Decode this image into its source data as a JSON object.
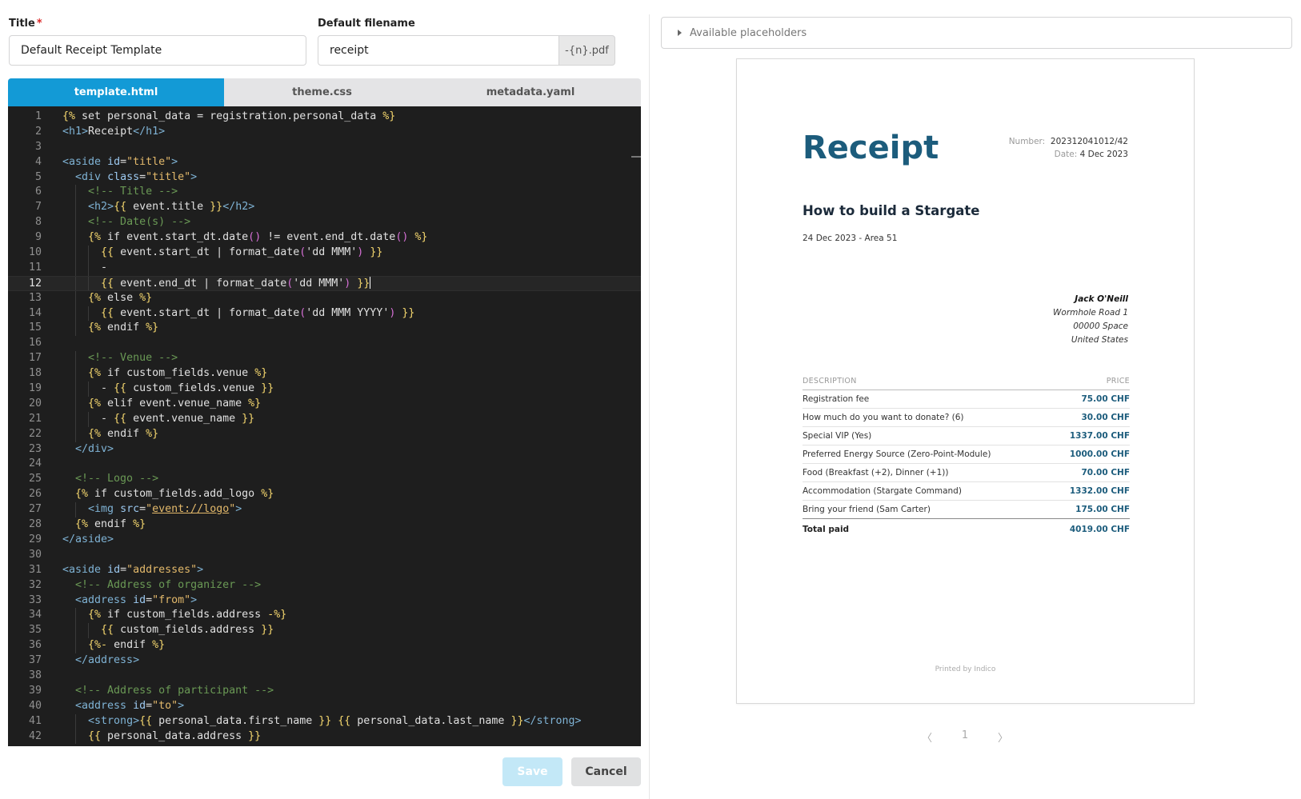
{
  "form": {
    "title_label": "Title",
    "title_required_mark": "*",
    "title_value": "Default Receipt Template",
    "filename_label": "Default filename",
    "filename_value": "receipt",
    "filename_suffix": "-{n}.pdf"
  },
  "tabs": [
    "template.html",
    "theme.css",
    "metadata.yaml"
  ],
  "editor": {
    "line_numbers": [
      "1",
      "2",
      "3",
      "4",
      "5",
      "6",
      "7",
      "8",
      "9",
      "10",
      "11",
      "12",
      "13",
      "14",
      "15",
      "16",
      "17",
      "18",
      "19",
      "20",
      "21",
      "22",
      "23",
      "24",
      "25",
      "26",
      "27",
      "28",
      "29",
      "30",
      "31",
      "32",
      "33",
      "34",
      "35",
      "36",
      "37",
      "38",
      "39",
      "40",
      "41",
      "42"
    ],
    "lines": [
      "{% set personal_data = registration.personal_data %}",
      "<h1>Receipt</h1>",
      "",
      "<aside id=\"title\">",
      "  <div class=\"title\">",
      "    <!-- Title -->",
      "    <h2>{{ event.title }}</h2>",
      "    <!-- Date(s) -->",
      "    {% if event.start_dt.date() != event.end_dt.date() %}",
      "      {{ event.start_dt | format_date('dd MMM') }}",
      "      -",
      "      {{ event.end_dt | format_date('dd MMM') }}",
      "    {% else %}",
      "      {{ event.start_dt | format_date('dd MMM YYYY') }}",
      "    {% endif %}",
      "",
      "    <!-- Venue -->",
      "    {% if custom_fields.venue %}",
      "      - {{ custom_fields.venue }}",
      "    {% elif event.venue_name %}",
      "      - {{ event.venue_name }}",
      "    {% endif %}",
      "  </div>",
      "",
      "  <!-- Logo -->",
      "  {% if custom_fields.add_logo %}",
      "    <img src=\"event://logo\">",
      "  {% endif %}",
      "</aside>",
      "",
      "<aside id=\"addresses\">",
      "  <!-- Address of organizer -->",
      "  <address id=\"from\">",
      "    {% if custom_fields.address -%}",
      "      {{ custom_fields.address }}",
      "    {%- endif %}",
      "  </address>",
      "",
      "  <!-- Address of participant -->",
      "  <address id=\"to\">",
      "    <strong>{{ personal_data.first_name }} {{ personal_data.last_name }}</strong>",
      "    {{ personal_data.address }}"
    ]
  },
  "buttons": {
    "save": "Save",
    "cancel": "Cancel"
  },
  "placeholders_label": "Available placeholders",
  "receipt": {
    "heading": "Receipt",
    "number_label": "Number:",
    "number_value": "202312041012/42",
    "date_label": "Date:",
    "date_value": "4 Dec 2023",
    "event_title": "How to build a Stargate",
    "event_sub": "24 Dec 2023 - Area 51",
    "address": [
      "Jack O'Neill",
      "Wormhole Road 1",
      "00000 Space",
      "United States"
    ],
    "col_description": "DESCRIPTION",
    "col_price": "PRICE",
    "items": [
      {
        "desc": "Registration fee",
        "price": "75.00 CHF"
      },
      {
        "desc": "How much do you want to donate? (6)",
        "price": "30.00 CHF"
      },
      {
        "desc": "Special VIP (Yes)",
        "price": "1337.00 CHF"
      },
      {
        "desc": "Preferred Energy Source (Zero-Point-Module)",
        "price": "1000.00 CHF"
      },
      {
        "desc": "Food (Breakfast (+2), Dinner (+1))",
        "price": "70.00 CHF"
      },
      {
        "desc": "Accommodation (Stargate Command)",
        "price": "1332.00 CHF"
      },
      {
        "desc": "Bring your friend (Sam Carter)",
        "price": "175.00 CHF"
      }
    ],
    "total_label": "Total paid",
    "total_value": "4019.00 CHF",
    "printed_by": "Printed by Indico"
  },
  "pager": {
    "prev": "〈",
    "page": "1",
    "next": "〉"
  }
}
